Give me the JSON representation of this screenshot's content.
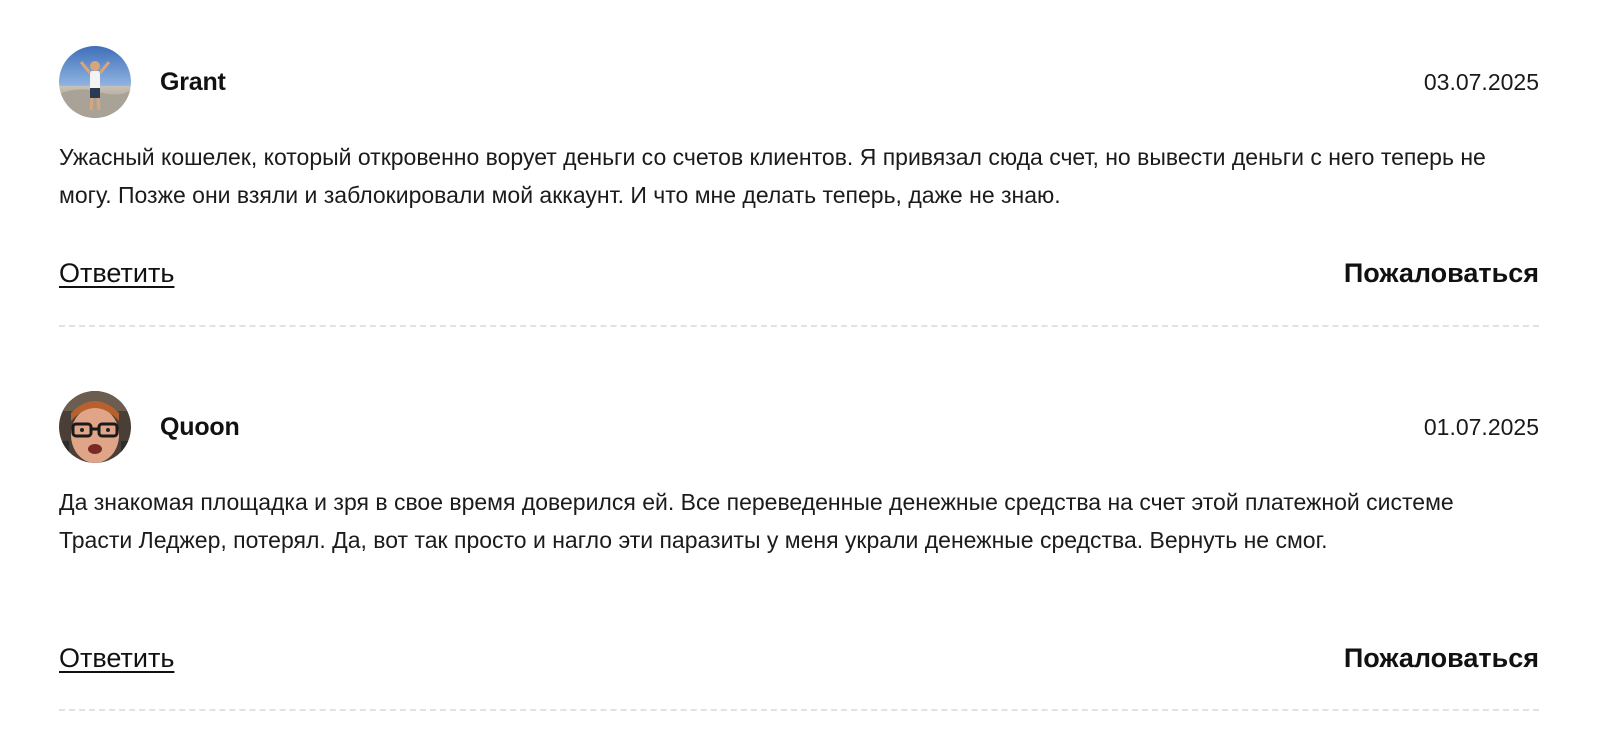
{
  "comments": [
    {
      "author": "Grant",
      "date": "03.07.2025",
      "text": "Ужасный кошелек, который откровенно ворует деньги со счетов клиентов. Я привязал сюда счет, но вывести деньги с него теперь не могу. Позже они взяли и заблокировали мой аккаунт. И что мне делать теперь, даже не знаю.",
      "reply_label": "Ответить",
      "report_label": "Пожаловаться"
    },
    {
      "author": "Quoon",
      "date": "01.07.2025",
      "text": "Да знакомая площадка и зря в свое время доверился ей. Все переведенные денежные средства на счет этой платежной системе Трасти Леджер, потерял. Да, вот так просто и нагло эти паразиты у меня украли денежные средства. Вернуть не смог.",
      "reply_label": "Ответить",
      "report_label": "Пожаловаться"
    }
  ]
}
